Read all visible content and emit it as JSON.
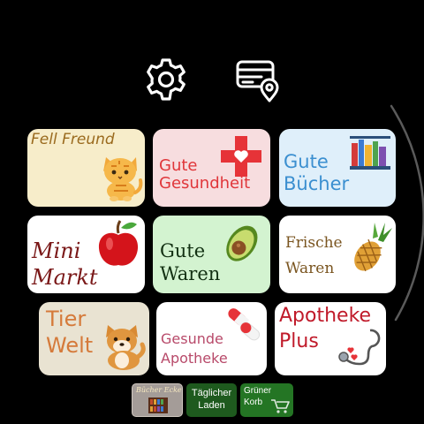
{
  "toolbar": {
    "settings_icon": "gear-icon",
    "store_locator_icon": "card-location-icon"
  },
  "tiles": [
    {
      "label": "Fell Freund",
      "icon": "kitten",
      "bg": "#f7edca"
    },
    {
      "label": "Gute\nGesundheit",
      "icon": "red-cross-heart",
      "bg": "#f7dddf"
    },
    {
      "label": "Gute\nBücher",
      "icon": "books",
      "bg": "#dfeffa"
    },
    {
      "label": "Mini\nMarkt",
      "icon": "apple",
      "bg": "#ffffff"
    },
    {
      "label": "Gute\nWaren",
      "icon": "avocado",
      "bg": "#d3f3d0"
    },
    {
      "label": "Frische\nWaren",
      "icon": "pineapple",
      "bg": "#ffffff"
    },
    {
      "label": "Tier\nWelt",
      "icon": "shiba-dog",
      "bg": "#e9e3d2"
    },
    {
      "label": "Gesunde\nApotheke",
      "icon": "pills",
      "bg": "#ffffff"
    },
    {
      "label": "Apotheke\nPlus",
      "icon": "stethoscope",
      "bg": "#ffffff"
    }
  ],
  "dock": [
    {
      "label": "Bücher Ecke",
      "icon": "bookshelf"
    },
    {
      "label": "Täglicher\nLaden",
      "icon": ""
    },
    {
      "label": "Grüner\nKorb",
      "icon": "cart"
    }
  ]
}
